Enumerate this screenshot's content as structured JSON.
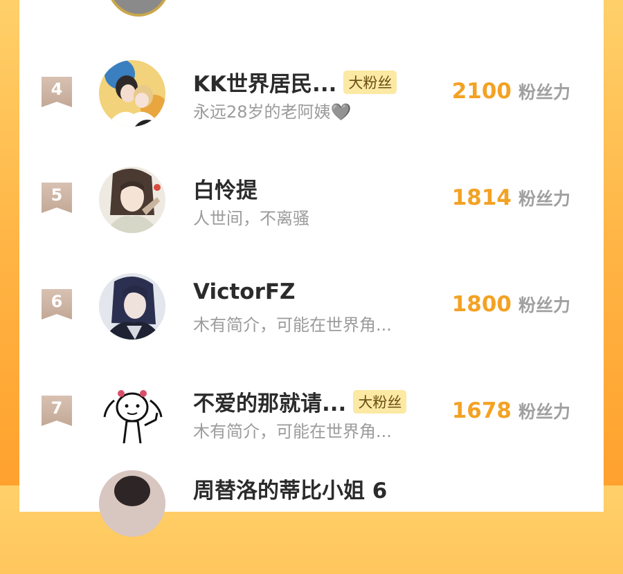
{
  "leaderboard": {
    "unit_label": "粉丝力",
    "rows": [
      {
        "rank": "4",
        "name": "KK世界居民...",
        "badge": "大粉丝",
        "bio": "永远28岁的老阿姨🩶",
        "score": "2100",
        "avatar": "couple-illustration"
      },
      {
        "rank": "5",
        "name": "白怜提",
        "badge": "",
        "bio": "人世间，不离骚",
        "score": "1814",
        "avatar": "ancient-costume-illustration"
      },
      {
        "rank": "6",
        "name": "VictorFZ",
        "badge": "",
        "bio": "木有简介，可能在世界角...",
        "score": "1800",
        "avatar": "dark-hair-illustration"
      },
      {
        "rank": "7",
        "name": "不爱的那就请...",
        "badge": "大粉丝",
        "bio": "木有简介，可能在世界角...",
        "score": "1678",
        "avatar": "stick-figure-doodle"
      },
      {
        "rank": "",
        "name": "周替洛的蒂比小姐 6",
        "badge": "",
        "bio": "",
        "score": "",
        "avatar": "partial-avatar"
      }
    ]
  },
  "colors": {
    "accent": "#f3a224",
    "badge_bg": "#fbe9a4",
    "rank_badge": "#c9ae9c",
    "background_gradient": "#ffb545"
  }
}
